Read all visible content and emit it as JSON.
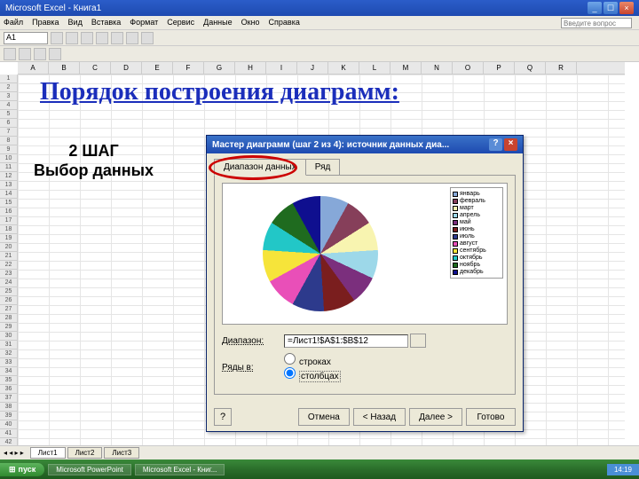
{
  "app": {
    "title": "Microsoft Excel - Книга1"
  },
  "menus": [
    "Файл",
    "Правка",
    "Вид",
    "Вставка",
    "Формат",
    "Сервис",
    "Данные",
    "Окно",
    "Справка"
  ],
  "question_box": "Введите вопрос",
  "namebox_value": "A1",
  "cols": [
    "A",
    "B",
    "C",
    "D",
    "E",
    "F",
    "G",
    "H",
    "I",
    "J",
    "K",
    "L",
    "M",
    "N",
    "O",
    "P",
    "Q",
    "R"
  ],
  "overlay": {
    "title": "Порядок построения диаграмм:",
    "step_line1": "2 ШАГ",
    "step_line2": "Выбор данных"
  },
  "dialog": {
    "title": "Мастер диаграмм (шаг 2 из 4): источник данных диа...",
    "tab1": "Диапазон данных",
    "tab2": "Ряд",
    "range_label": "Диапазон:",
    "range_value": "=Лист1!$A$1:$B$12",
    "rows_in_label": "Ряды в:",
    "radio_rows": "строках",
    "radio_cols": "столбцах",
    "btn_cancel": "Отмена",
    "btn_back": "< Назад",
    "btn_next": "Далее >",
    "btn_finish": "Готово",
    "help_icon": "?"
  },
  "chart_data": {
    "type": "pie",
    "title": "",
    "categories": [
      "январь",
      "февраль",
      "март",
      "апрель",
      "май",
      "июнь",
      "июль",
      "август",
      "сентябрь",
      "октябрь",
      "ноябрь",
      "декабрь"
    ],
    "values": [
      8,
      8,
      8,
      8,
      8,
      9,
      9,
      9,
      9,
      8,
      8,
      8
    ],
    "colors": [
      "#86a8d8",
      "#863f5a",
      "#f8f4b0",
      "#9dd8e9",
      "#7b2f7d",
      "#7a1e1e",
      "#2d3a8c",
      "#e94fb8",
      "#f6e43a",
      "#22c7c7",
      "#1f6b1f",
      "#0f0f8f"
    ]
  },
  "sheets": [
    "Лист1",
    "Лист2",
    "Лист3"
  ],
  "taskbar": {
    "start": "пуск",
    "item1": "Microsoft PowerPoint",
    "item2": "Microsoft Excel - Книг...",
    "time": "14:19"
  }
}
